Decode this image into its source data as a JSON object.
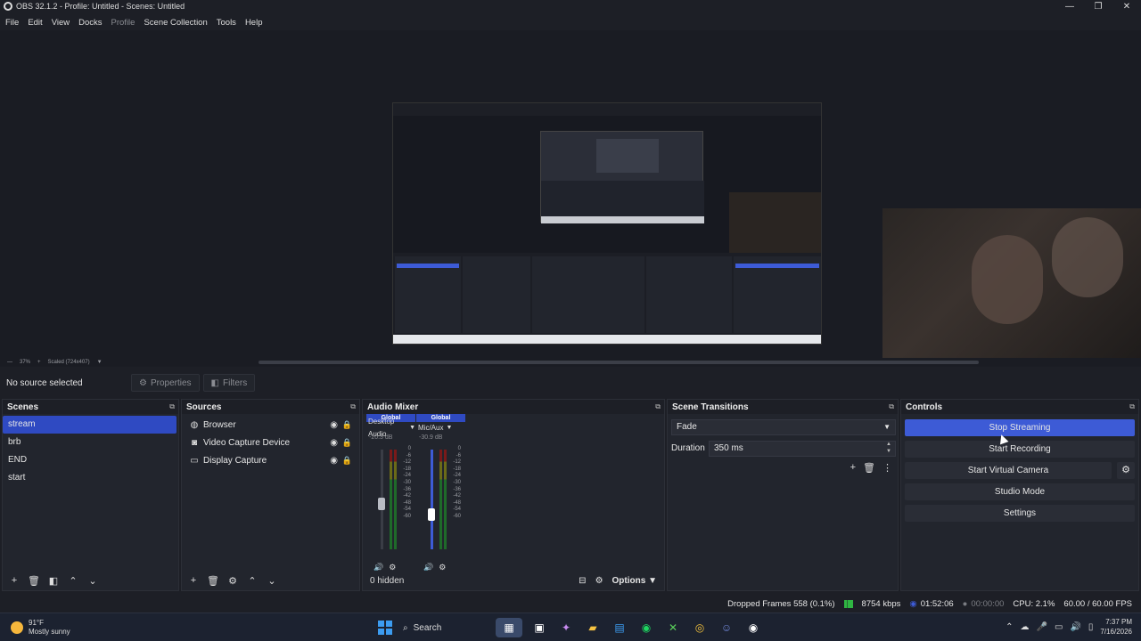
{
  "window": {
    "title": "OBS 32.1.2 - Profile: Untitled - Scenes: Untitled",
    "controls": [
      "—",
      "❐",
      "✕"
    ]
  },
  "menu": [
    "File",
    "Edit",
    "View",
    "Docks",
    "Profile",
    "Scene Collection",
    "Tools",
    "Help"
  ],
  "preview": {
    "zoom": "37%",
    "scale_mode": "Scaled (724x407)"
  },
  "context": {
    "no_source": "No source selected",
    "properties": "Properties",
    "filters": "Filters"
  },
  "scenes": {
    "title": "Scenes",
    "items": [
      "stream",
      "brb",
      "END",
      "start"
    ],
    "active_index": 0
  },
  "sources": {
    "title": "Sources",
    "items": [
      {
        "name": "Browser",
        "icon": "globe-icon"
      },
      {
        "name": "Video Capture Device",
        "icon": "camera-icon"
      },
      {
        "name": "Display Capture",
        "icon": "monitor-icon"
      }
    ]
  },
  "mixer": {
    "title": "Audio Mixer",
    "channels": [
      {
        "tag": "Global",
        "name": "Desktop Audio",
        "db": "-20.3 dB",
        "level": 0.55
      },
      {
        "tag": "Global",
        "name": "Mic/Aux",
        "db": "-30.9 dB",
        "level": 0.3
      }
    ],
    "scale": [
      "0",
      "-6",
      "-12",
      "-18",
      "-24",
      "-30",
      "-36",
      "-42",
      "-48",
      "-54",
      "-60"
    ],
    "hidden": "0 hidden",
    "options": "Options"
  },
  "transitions": {
    "title": "Scene Transitions",
    "selected": "Fade",
    "duration_label": "Duration",
    "duration": "350 ms"
  },
  "controls": {
    "title": "Controls",
    "stop_streaming": "Stop Streaming",
    "start_recording": "Start Recording",
    "start_virtual_camera": "Start Virtual Camera",
    "studio_mode": "Studio Mode",
    "settings": "Settings"
  },
  "status": {
    "dropped_frames": "Dropped Frames 558 (0.1%)",
    "bitrate": "8754 kbps",
    "stream_time": "01:52:06",
    "record_time": "00:00:00",
    "cpu": "CPU: 2.1%",
    "fps": "60.00 / 60.00 FPS"
  },
  "taskbar": {
    "temp": "91°F",
    "weather": "Mostly sunny",
    "search": "Search",
    "time": "7:37 PM",
    "date": "7/16/2026"
  },
  "colors": {
    "accent": "#3d5bd6",
    "selection": "#2f4ac2",
    "background": "#1d1f26",
    "panel": "#22252d"
  }
}
